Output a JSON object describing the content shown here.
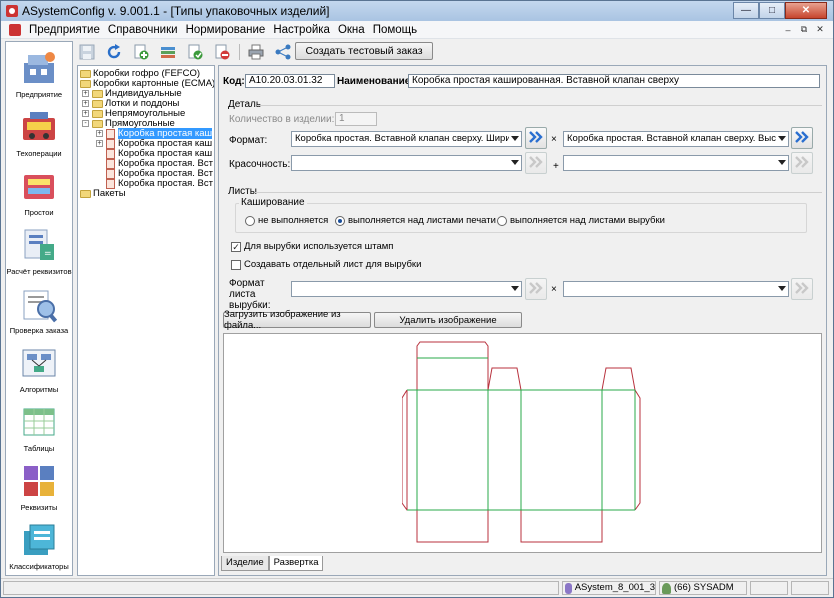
{
  "window": {
    "title": "ASystemConfig v. 9.001.1 - [Типы упаковочных изделий]",
    "buttons": [
      "minimize",
      "maximize",
      "close"
    ]
  },
  "menubar": {
    "items": [
      {
        "label": "Предприятие"
      },
      {
        "label": "Справочники"
      },
      {
        "label": "Нормирование"
      },
      {
        "label": "Настройка"
      },
      {
        "label": "Окна"
      },
      {
        "label": "Помощь"
      }
    ]
  },
  "nav": {
    "items": [
      {
        "label": "Предприятие",
        "icon": "enterprise-icon"
      },
      {
        "label": "Техоперации",
        "icon": "operations-icon"
      },
      {
        "label": "Простои",
        "icon": "downtime-icon"
      },
      {
        "label": "Расчёт реквизитов",
        "icon": "calculation-icon"
      },
      {
        "label": "Проверка заказа",
        "icon": "order-check-icon"
      },
      {
        "label": "Алгоритмы",
        "icon": "algorithms-icon"
      },
      {
        "label": "Таблицы",
        "icon": "tables-icon"
      },
      {
        "label": "Реквизиты",
        "icon": "requisites-icon"
      },
      {
        "label": "Классификаторы",
        "icon": "classifiers-icon"
      }
    ]
  },
  "toolbar": {
    "icons": [
      "save-icon",
      "refresh-icon",
      "add-icon",
      "add-multiple-icon",
      "copy-icon",
      "delete-icon",
      "print-icon",
      "tree-icon"
    ],
    "test_order_label": "Создать тестовый заказ"
  },
  "tree": {
    "nodes": [
      {
        "label": "Коробки гофро (FEFCO)",
        "level": 0,
        "type": "folder"
      },
      {
        "label": "Коробки картонные (ECMA)",
        "level": 0,
        "type": "folder"
      },
      {
        "label": "Индивидуальные",
        "level": 1,
        "type": "folder",
        "expander": "+"
      },
      {
        "label": "Лотки и поддоны",
        "level": 1,
        "type": "folder",
        "expander": "+"
      },
      {
        "label": "Непрямоугольные",
        "level": 1,
        "type": "folder",
        "expander": "+"
      },
      {
        "label": "Прямоугольные",
        "level": 1,
        "type": "folder",
        "expander": "-"
      },
      {
        "label": "Коробка простая каш",
        "level": 2,
        "type": "doc",
        "expander": "+",
        "selected": true
      },
      {
        "label": "Коробка простая каш",
        "level": 2,
        "type": "doc",
        "expander": "+"
      },
      {
        "label": "Коробка простая каш",
        "level": 2,
        "type": "doc"
      },
      {
        "label": "Коробка простая. Вст",
        "level": 2,
        "type": "doc"
      },
      {
        "label": "Коробка простая. Вст",
        "level": 2,
        "type": "doc"
      },
      {
        "label": "Коробка простая. Вст",
        "level": 2,
        "type": "doc"
      },
      {
        "label": "Пакеты",
        "level": 0,
        "type": "folder"
      }
    ]
  },
  "detail": {
    "code_label": "Код:",
    "code_value": "A10.20.03.01.32",
    "name_label": "Наименование:",
    "name_value": "Коробка простая кашированная. Вставной клапан сверху",
    "part_group": "Деталь",
    "quantity_label": "Количество в изделии:",
    "quantity_value": "1",
    "format_label": "Формат:",
    "format_width": "Коробка простая. Вставной клапан сверху. Ширина",
    "format_height": "Коробка простая. Вставной клапан сверху. Высота",
    "times_sign": "×",
    "plus_sign": "+",
    "color_label": "Красочность:",
    "color_value_1": "",
    "color_value_2": "",
    "sheets_group": "Листы",
    "lamination_group": "Каширование",
    "radio_not": "не выполняется",
    "radio_print": "выполняется над листами печати",
    "radio_cut": "выполняется над листами вырубки",
    "radio_selected": "print",
    "check_stamp": "Для вырубки используется штамп",
    "check_stamp_checked": true,
    "check_separate": "Создавать отдельный лист для вырубки",
    "check_separate_checked": false,
    "sheet_format_label": "Формат листа вырубки:",
    "sheet_format_1": "",
    "sheet_format_2": "",
    "load_image_label": "Загрузить изображение из файла...",
    "delete_image_label": "Удалить изображение",
    "tabs": [
      {
        "label": "Изделие",
        "active": false
      },
      {
        "label": "Развертка",
        "active": true
      }
    ]
  },
  "status": {
    "database": "ASystem_8_001_3",
    "user": "(66) SYSADM"
  },
  "colors": {
    "cut_line": "#b8323e",
    "fold_line": "#2aa84a",
    "selection": "#3399ff"
  }
}
